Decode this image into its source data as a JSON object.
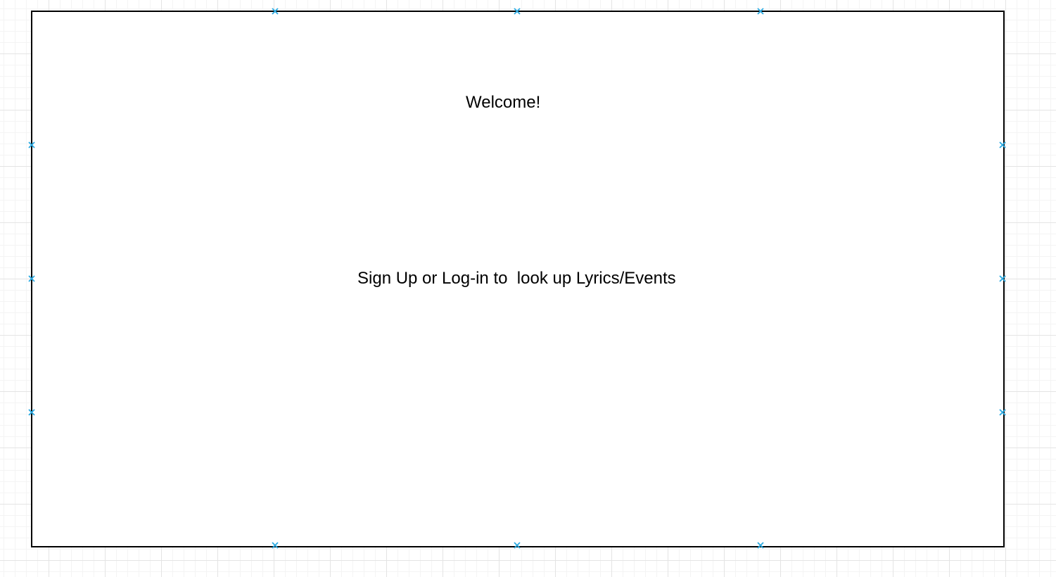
{
  "canvas": {
    "background": "#ffffff",
    "grid_color": "#e4e4e4",
    "handle_color": "#29a8e0"
  },
  "frame": {
    "welcome_text": "Welcome!",
    "prompt_text": "Sign Up or Log-in to  look up Lyrics/Events",
    "border_color": "#000000"
  }
}
